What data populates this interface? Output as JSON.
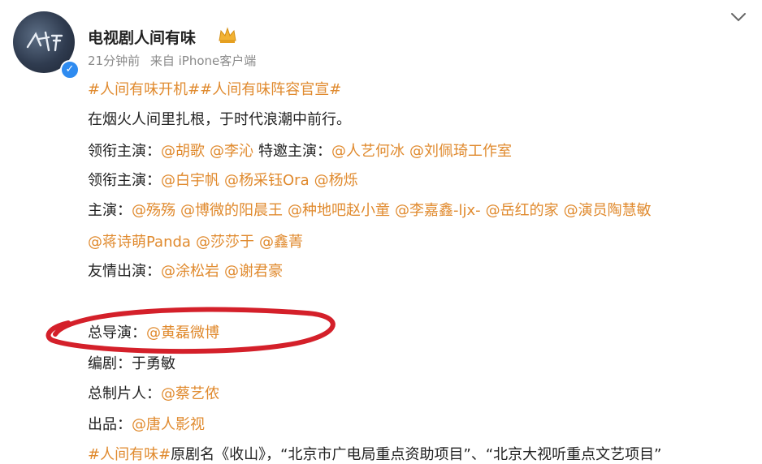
{
  "user": {
    "name": "电视剧人间有味",
    "time": "21分钟前",
    "source": "来自 iPhone客户端",
    "avatar_icon": "account-avatar",
    "badge_icon": "crown-icon",
    "verified_icon": "verified-icon"
  },
  "post": {
    "topics": "#人间有味开机##人间有味阵容官宣#",
    "slogan": "在烟火人间里扎根，于时代浪潮中前行。",
    "lead_label": "领衔主演：",
    "lead_mentions": [
      "@胡歌",
      "@李沁"
    ],
    "special_label": "特邀主演：",
    "special_mentions": [
      "@人艺何冰",
      "@刘佩琦工作室"
    ],
    "lead2_label": "领衔主演：",
    "lead2_mentions": [
      "@白宇帆",
      "@杨采钰Ora",
      "@杨烁"
    ],
    "main_label": "主演：",
    "main_mentions_1": [
      "@殇殇",
      "@博微的阳晨王",
      "@种地吧赵小童",
      "@李嘉鑫-ljx-",
      "@岳红的家",
      "@演员陶慧敏"
    ],
    "main_mentions_2": [
      "@蒋诗萌Panda",
      "@莎莎于",
      "@鑫菁"
    ],
    "friend_label": "友情出演：",
    "friend_mentions": [
      "@涂松岩",
      "@谢君豪"
    ],
    "director_label": "总导演：",
    "director_mention": "@黄磊微博",
    "writer_label": "编剧：",
    "writer_name": "于勇敏",
    "producer_label": "总制片人：",
    "producer_mention": "@蔡艺侬",
    "publisher_label": "出品：",
    "publisher_mention": "@唐人影视",
    "footer_topic": "#人间有味#",
    "footer_text": "原剧名《收山》，“北京市广电局重点资助项目”、“北京大视听重点文艺项目”"
  },
  "colors": {
    "accent": "#e08a2e",
    "circle": "#d4202a",
    "meta": "#8a8a8a"
  }
}
